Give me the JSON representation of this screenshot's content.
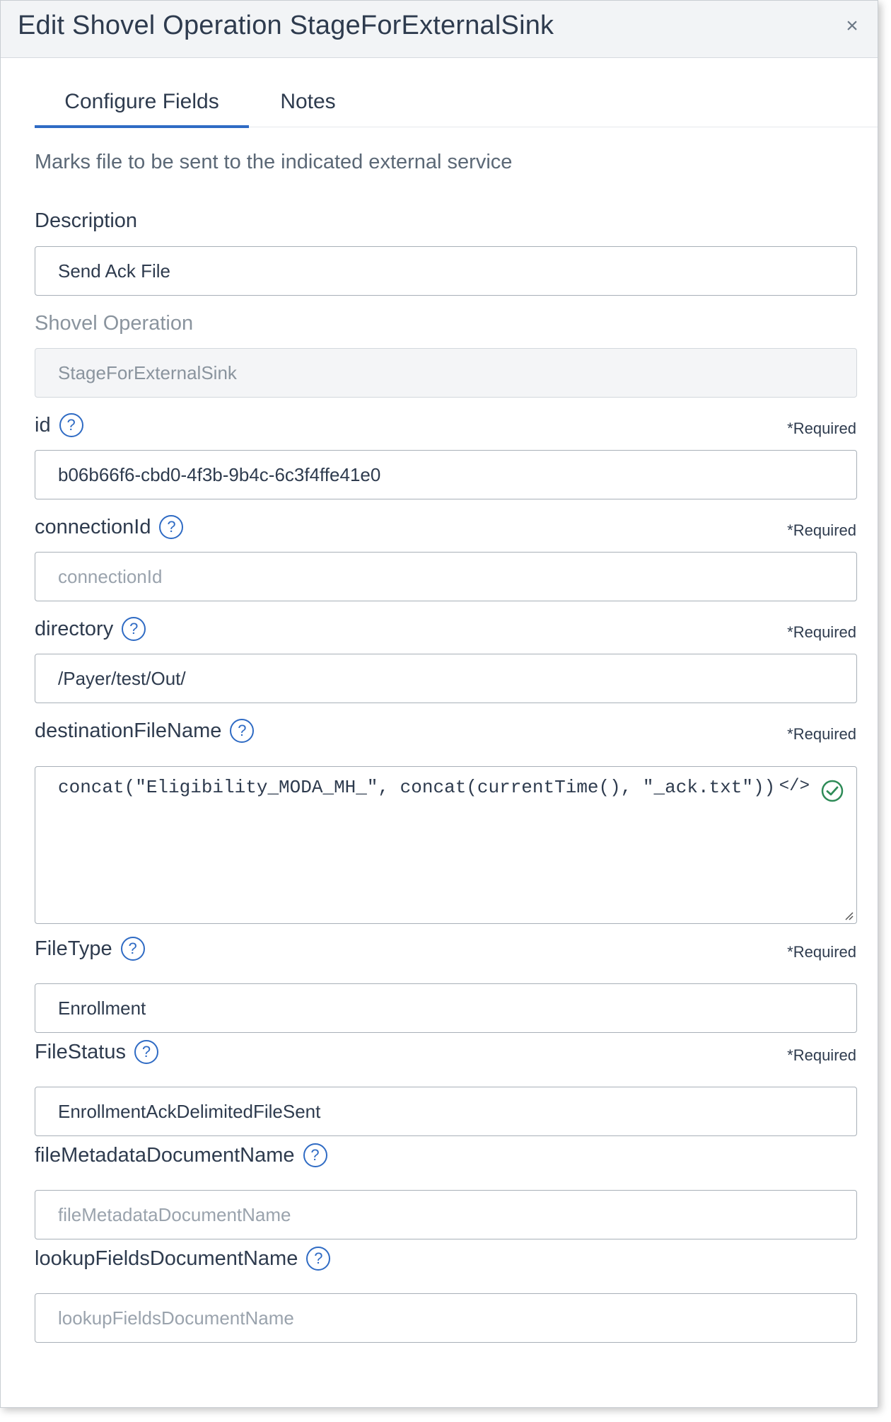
{
  "modal": {
    "title": "Edit Shovel Operation StageForExternalSink",
    "close_glyph": "×"
  },
  "tabs": [
    {
      "label": "Configure Fields"
    },
    {
      "label": "Notes"
    }
  ],
  "description_text": "Marks file to be sent to the indicated external service",
  "required_text": "*Required",
  "help_glyph": "?",
  "fields": {
    "description": {
      "label": "Description",
      "value": "Send Ack File"
    },
    "shovel_operation": {
      "label": "Shovel Operation",
      "value": "StageForExternalSink"
    },
    "id": {
      "label": "id",
      "value": "b06b66f6-cbd0-4f3b-9b4c-6c3f4ffe41e0"
    },
    "connection_id": {
      "label": "connectionId",
      "value": "",
      "placeholder": "connectionId"
    },
    "directory": {
      "label": "directory",
      "value": "/Payer/test/Out/"
    },
    "destination_file_name": {
      "label": "destinationFileName",
      "value": "concat(\"Eligibility_MODA_MH_\", concat(currentTime(), \"_ack.txt\"))",
      "code_icon": "</>",
      "status_icon": "check-circle-icon"
    },
    "file_type": {
      "label": "FileType",
      "value": "Enrollment"
    },
    "file_status": {
      "label": "FileStatus",
      "value": "EnrollmentAckDelimitedFileSent"
    },
    "file_metadata_document_name": {
      "label": "fileMetadataDocumentName",
      "value": "",
      "placeholder": "fileMetadataDocumentName"
    },
    "lookup_fields_document_name": {
      "label": "lookupFieldsDocumentName",
      "value": "",
      "placeholder": "lookupFieldsDocumentName"
    }
  },
  "colors": {
    "accent": "#2f6bc4",
    "success": "#2e8b57",
    "header_bg": "#f2f4f6"
  }
}
